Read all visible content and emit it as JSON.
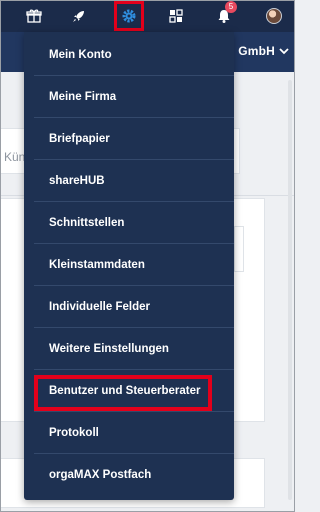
{
  "toolbar": {
    "icons": [
      "gift-icon",
      "rocket-icon",
      "settings-gear-icon",
      "apps-grid-icon",
      "bell-icon",
      "avatar"
    ],
    "notification_count": "5"
  },
  "company": {
    "name_partial": "GmbH"
  },
  "background": {
    "search_placeholder_partial": "Kün"
  },
  "menu": {
    "items": [
      {
        "label": "Mein Konto"
      },
      {
        "label": "Meine Firma"
      },
      {
        "label": "Briefpapier"
      },
      {
        "label": "shareHUB"
      },
      {
        "label": "Schnittstellen"
      },
      {
        "label": "Kleinstammdaten"
      },
      {
        "label": "Individuelle Felder"
      },
      {
        "label": "Weitere Einstellungen"
      },
      {
        "label": "Benutzer und Steuerberater"
      },
      {
        "label": "Protokoll"
      },
      {
        "label": "orgaMAX Postfach"
      }
    ],
    "highlighted_item": "Benutzer und Steuerberater"
  },
  "colors": {
    "toolbar_bg": "#1b2b4a",
    "menu_bg": "#1e3152",
    "highlight": "#e3001b",
    "badge": "#e84a5f",
    "active_icon": "#2f8ee0"
  }
}
